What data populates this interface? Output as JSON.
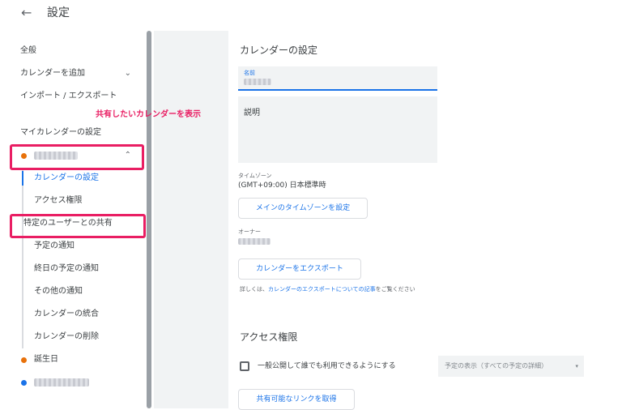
{
  "header": {
    "back_icon": "arrow-left-icon",
    "title": "設定"
  },
  "sidebar": {
    "general": "全般",
    "add_calendar": "カレンダーを追加",
    "import_export": "インポート / エクスポート",
    "my_calendars_heading": "マイカレンダーの設定",
    "calendar_owner": {
      "dot_color": "#e8710a"
    },
    "sub_items": [
      "カレンダーの設定",
      "アクセス権限",
      "特定のユーザーとの共有",
      "予定の通知",
      "終日の予定の通知",
      "その他の通知",
      "カレンダーの統合",
      "カレンダーの削除"
    ],
    "birthdays": {
      "label": "誕生日",
      "dot_color": "#e8710a"
    },
    "other_calendar": {
      "dot_color": "#1a73e8"
    }
  },
  "annotation": {
    "text": "共有したいカレンダーを表示",
    "color": "#e91e63"
  },
  "calendar_settings": {
    "heading": "カレンダーの設定",
    "name_label": "名前",
    "description_label": "説明",
    "timezone_label": "タイムゾーン",
    "timezone_value": "(GMT+09:00) 日本標準時",
    "set_main_timezone_button": "メインのタイムゾーンを設定",
    "owner_label": "オーナー",
    "export_button": "カレンダーをエクスポート",
    "help_prefix": "詳しくは、",
    "help_link": "カレンダーのエクスポートについての記事",
    "help_suffix": "をご覧ください"
  },
  "access": {
    "heading": "アクセス権限",
    "public_checkbox_label": "一般公開して誰でも利用できるようにする",
    "public_checked": false,
    "visibility_select": "予定の表示（すべての予定の詳細）",
    "share_link_button": "共有可能なリンクを取得"
  },
  "colors": {
    "accent": "#1a73e8",
    "highlight": "#e91e63"
  }
}
